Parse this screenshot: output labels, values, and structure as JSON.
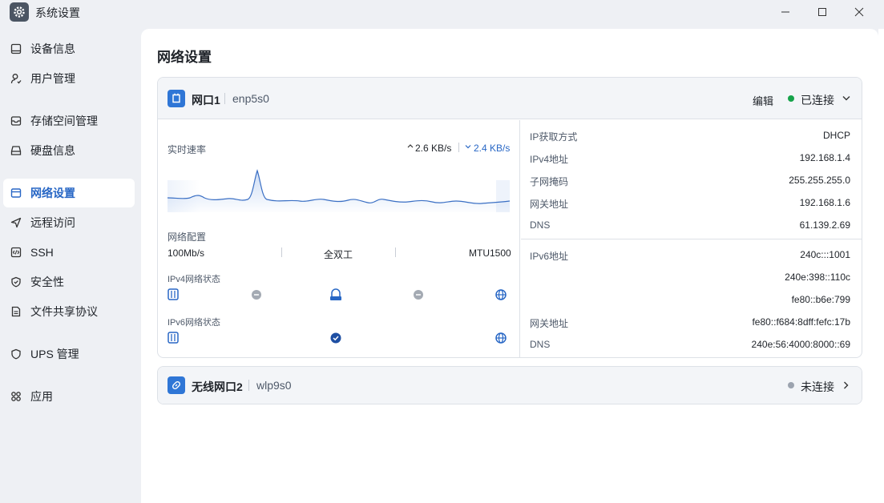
{
  "window": {
    "title": "系统设置"
  },
  "sidebar": {
    "items": [
      {
        "label": "设备信息",
        "icon": "device-icon"
      },
      {
        "label": "用户管理",
        "icon": "user-icon"
      },
      {
        "label": "存储空间管理",
        "icon": "storage-icon"
      },
      {
        "label": "硬盘信息",
        "icon": "disk-icon"
      },
      {
        "label": "网络设置",
        "icon": "network-icon",
        "active": true
      },
      {
        "label": "远程访问",
        "icon": "send-icon"
      },
      {
        "label": "SSH",
        "icon": "code-icon"
      },
      {
        "label": "安全性",
        "icon": "shield-icon"
      },
      {
        "label": "文件共享协议",
        "icon": "file-icon"
      },
      {
        "label": "UPS 管理",
        "icon": "ups-icon"
      },
      {
        "label": "应用",
        "icon": "apps-icon"
      }
    ]
  },
  "main": {
    "title": "网络设置",
    "port1": {
      "name": "网口1",
      "interface": "enp5s0",
      "edit_label": "编辑",
      "status": "已连接",
      "status_color": "#16a34a",
      "speed": {
        "label": "实时速率",
        "up": "2.6 KB/s",
        "down": "2.4 KB/s"
      },
      "config": {
        "label": "网络配置",
        "speed": "100Mb/s",
        "duplex": "全双工",
        "mtu": "MTU1500"
      },
      "ipv4_status_label": "IPv4网络状态",
      "ipv6_status_label": "IPv6网络状态",
      "ipv4": [
        {
          "label": "IP获取方式",
          "value": "DHCP"
        },
        {
          "label": "IPv4地址",
          "value": "192.168.1.4"
        },
        {
          "label": "子网掩码",
          "value": "255.255.255.0"
        },
        {
          "label": "网关地址",
          "value": "192.168.1.6"
        },
        {
          "label": "DNS",
          "value": "61.139.2.69"
        }
      ],
      "ipv6": {
        "address_label": "IPv6地址",
        "addresses": [
          "240c:::1001",
          "240e:398::110c",
          "fe80::b6e:799"
        ],
        "gateway_label": "网关地址",
        "gateway": "fe80::f684:8dff:fefc:17b",
        "dns_label": "DNS",
        "dns": "240e:56:4000:8000::69"
      }
    },
    "port2": {
      "name": "无线网口2",
      "interface": "wlp9s0",
      "status": "未连接",
      "status_color": "#9ca3af"
    },
    "accent": "#2867c5"
  }
}
